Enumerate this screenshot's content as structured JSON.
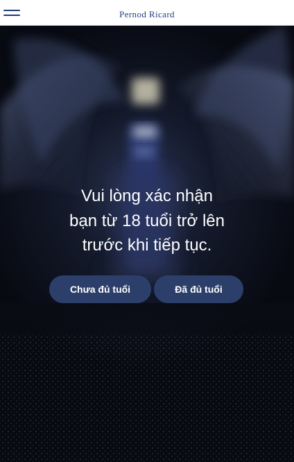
{
  "header": {
    "brand": "Pernod Ricard",
    "menu_icon": "hamburger-menu-icon",
    "brand_color": "#1f3f7c"
  },
  "age_gate": {
    "prompt_lines": [
      "Vui lòng xác nhận",
      "bạn từ 18 tuổi trở lên",
      "trước khi tiếp tục."
    ],
    "under_age_button": "Chưa đủ tuổi",
    "of_age_button": "Đã đủ tuổi",
    "button_color": "#2c3f6b"
  }
}
